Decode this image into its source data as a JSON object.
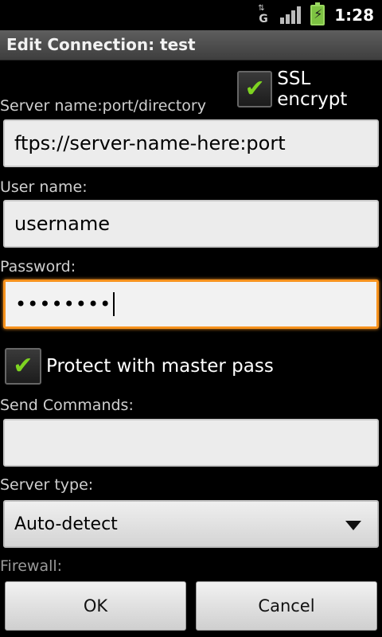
{
  "status_bar": {
    "network_type": "G",
    "clock": "1:28"
  },
  "dialog": {
    "title": "Edit Connection: test"
  },
  "ssl": {
    "label": "SSL encrypt",
    "checked": true
  },
  "server": {
    "label": "Server name:port/directory",
    "value": "ftps://server-name-here:port"
  },
  "username": {
    "label": "User name:",
    "value": "username"
  },
  "password": {
    "label": "Password:",
    "value": "••••••••"
  },
  "master_pass": {
    "label": "Protect with master pass",
    "checked": true
  },
  "send_commands": {
    "label": "Send Commands:",
    "value": ""
  },
  "server_type": {
    "label": "Server type:",
    "selected": "Auto-detect"
  },
  "firewall": {
    "label": "Firewall:"
  },
  "buttons": {
    "ok": "OK",
    "cancel": "Cancel"
  },
  "colors": {
    "accent_check": "#7ed321",
    "focus_border": "#f7931e"
  }
}
